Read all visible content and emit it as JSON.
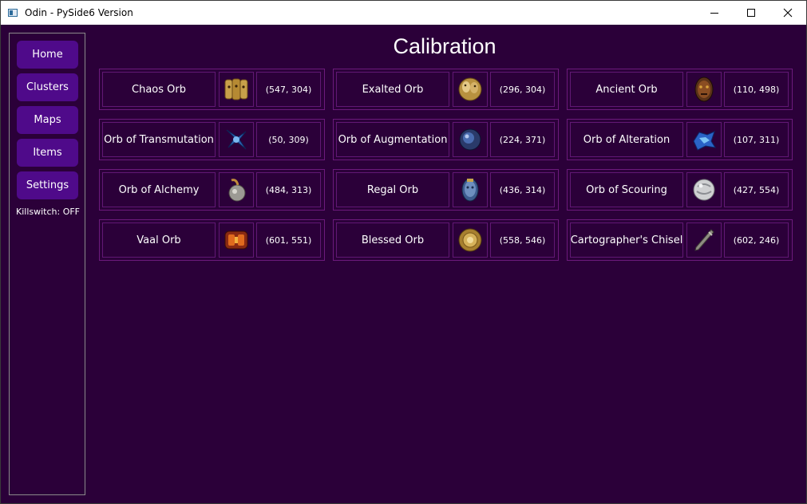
{
  "window": {
    "title": "Odin - PySide6 Version"
  },
  "sidebar": {
    "items": [
      {
        "label": "Home"
      },
      {
        "label": "Clusters"
      },
      {
        "label": "Maps"
      },
      {
        "label": "Items"
      },
      {
        "label": "Settings"
      }
    ],
    "killswitch": "Killswitch: OFF"
  },
  "page": {
    "title": "Calibration"
  },
  "currencies": [
    {
      "name": "Chaos Orb",
      "icon": "chaos-orb-icon",
      "coords": "(547, 304)"
    },
    {
      "name": "Exalted Orb",
      "icon": "exalted-orb-icon",
      "coords": "(296, 304)"
    },
    {
      "name": "Ancient Orb",
      "icon": "ancient-orb-icon",
      "coords": "(110, 498)"
    },
    {
      "name": "Orb of Transmutation",
      "icon": "orb-of-transmutation-icon",
      "coords": "(50, 309)"
    },
    {
      "name": "Orb of Augmentation",
      "icon": "orb-of-augmentation-icon",
      "coords": "(224, 371)"
    },
    {
      "name": "Orb of Alteration",
      "icon": "orb-of-alteration-icon",
      "coords": "(107, 311)"
    },
    {
      "name": "Orb of Alchemy",
      "icon": "orb-of-alchemy-icon",
      "coords": "(484, 313)"
    },
    {
      "name": "Regal Orb",
      "icon": "regal-orb-icon",
      "coords": "(436, 314)"
    },
    {
      "name": "Orb of Scouring",
      "icon": "orb-of-scouring-icon",
      "coords": "(427, 554)"
    },
    {
      "name": "Vaal Orb",
      "icon": "vaal-orb-icon",
      "coords": "(601, 551)"
    },
    {
      "name": "Blessed Orb",
      "icon": "blessed-orb-icon",
      "coords": "(558, 546)"
    },
    {
      "name": "Cartographer's Chisel",
      "icon": "cartographers-chisel-icon",
      "coords": "(602, 246)"
    }
  ],
  "colors": {
    "background": "#2b0039",
    "button": "#4f0a8a",
    "cell_border": "#6c1a7c",
    "text": "#ffffff"
  }
}
